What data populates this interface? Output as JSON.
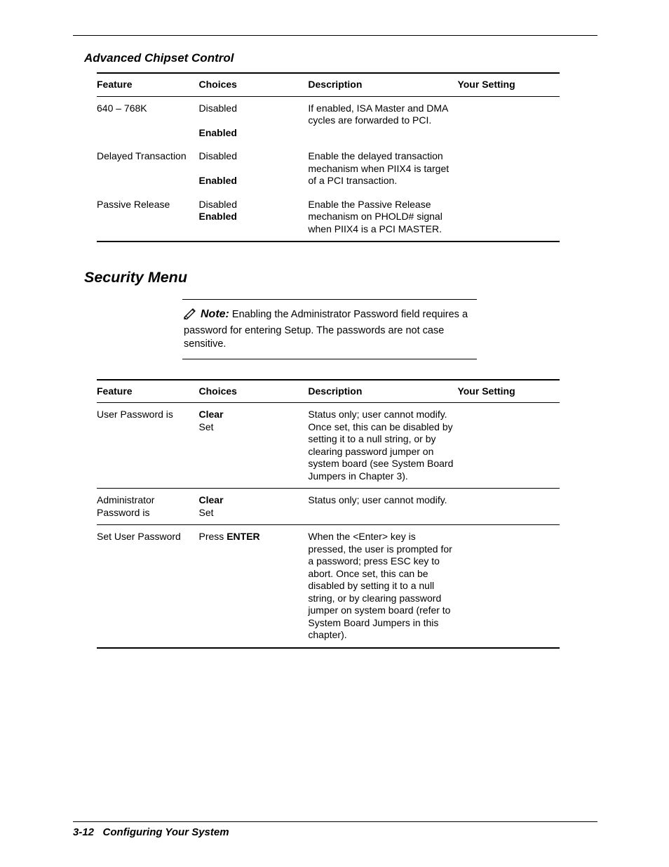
{
  "section1": {
    "title": "Advanced Chipset Control"
  },
  "headers": {
    "feature": "Feature",
    "choices": "Choices",
    "description": "Description",
    "setting": "Your Setting"
  },
  "t1": {
    "r0": {
      "feature": "640 – 768K",
      "c0": "Disabled",
      "c1": "Enabled",
      "desc": "If enabled, ISA Master and DMA cycles are forwarded to PCI."
    },
    "r1": {
      "feature": "Delayed Transaction",
      "c0": "Disabled",
      "c1": "Enabled",
      "desc": "Enable the delayed transaction mechanism when PIIX4 is target of a PCI transaction."
    },
    "r2": {
      "feature": "Passive Release",
      "c0": "Disabled",
      "c1": "Enabled",
      "desc": "Enable the Passive Release mechanism on PHOLD# signal when PIIX4 is a PCI MASTER."
    }
  },
  "section2": {
    "title": "Security Menu"
  },
  "note": {
    "label": "Note:",
    "text": " Enabling the Administrator Password field requires a password for entering Setup. The passwords are not case sensitive."
  },
  "t2": {
    "r0": {
      "feature": "User Password is",
      "c0": "Clear",
      "c1": "Set",
      "desc": "Status only; user cannot modify. Once set, this can be disabled by setting it to a null string, or by clearing password jumper on system board (see System Board Jumpers in Chapter 3)."
    },
    "r1": {
      "feature": "Administrator Password is",
      "c0": "Clear",
      "c1": "Set",
      "desc": "Status only; user cannot modify."
    },
    "r2": {
      "feature": "Set User Password",
      "c_pre": "Press ",
      "c_bold": "ENTER",
      "desc": "When the <Enter> key is pressed, the user is prompted for a password; press ESC key to abort. Once set, this can be disabled by setting it to a null string, or by clearing password jumper on system board (refer to System Board Jumpers in this chapter)."
    }
  },
  "footer": {
    "page": "3-12",
    "label": "Configuring Your System"
  }
}
